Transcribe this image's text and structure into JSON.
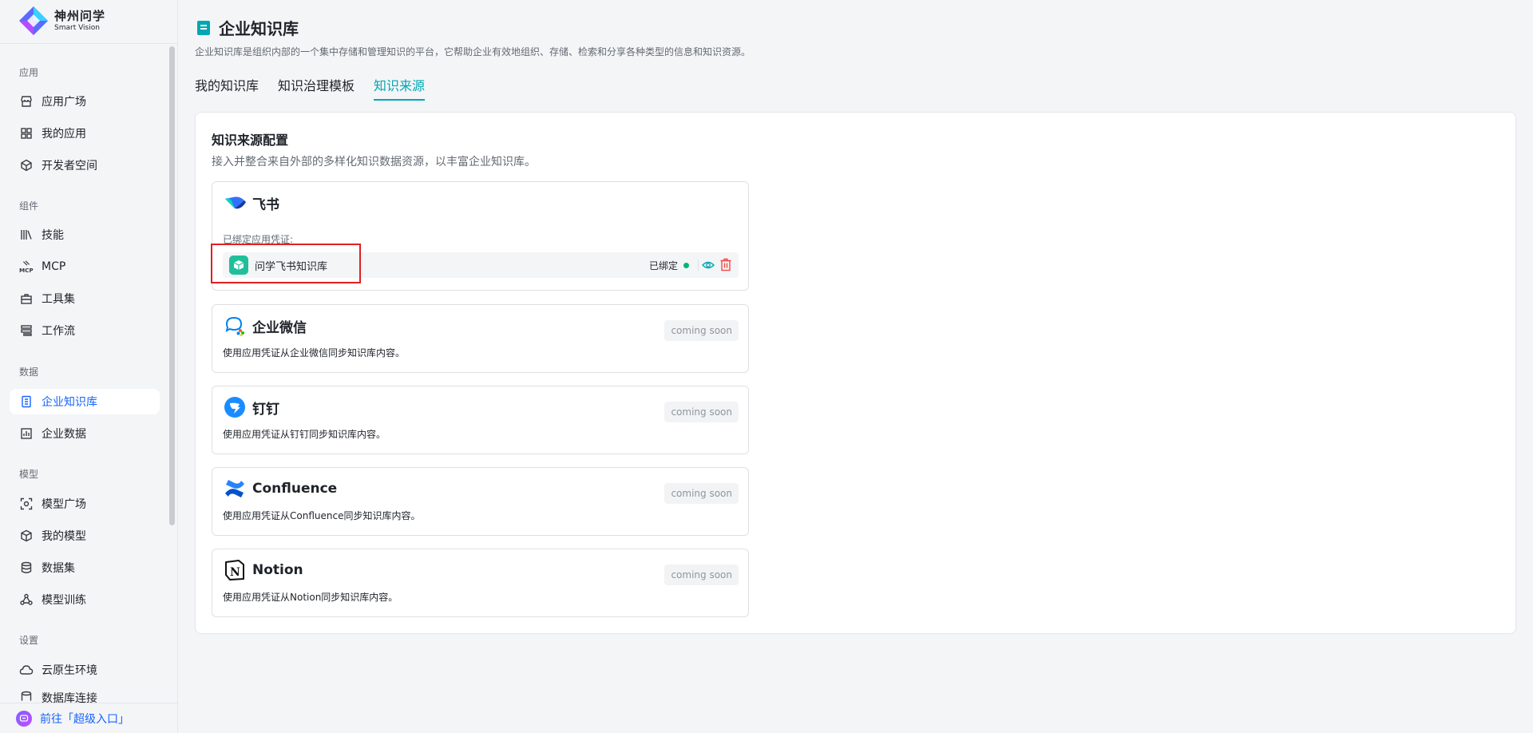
{
  "brand": {
    "name_cn": "神州问学",
    "name_en": "Smart Vision"
  },
  "sidebar": {
    "sections": [
      {
        "title": "应用",
        "items": [
          {
            "label": "应用广场",
            "icon": "store-icon"
          },
          {
            "label": "我的应用",
            "icon": "grid-icon"
          },
          {
            "label": "开发者空间",
            "icon": "cube-network-icon"
          }
        ]
      },
      {
        "title": "组件",
        "items": [
          {
            "label": "技能",
            "icon": "library-icon"
          },
          {
            "label": "MCP",
            "icon": "mcp-icon"
          },
          {
            "label": "工具集",
            "icon": "toolbox-icon"
          },
          {
            "label": "工作流",
            "icon": "workflow-icon"
          }
        ]
      },
      {
        "title": "数据",
        "items": [
          {
            "label": "企业知识库",
            "icon": "knowledge-icon",
            "active": true
          },
          {
            "label": "企业数据",
            "icon": "bar-chart-icon"
          }
        ]
      },
      {
        "title": "模型",
        "items": [
          {
            "label": "模型广场",
            "icon": "scan-icon"
          },
          {
            "label": "我的模型",
            "icon": "box-icon"
          },
          {
            "label": "数据集",
            "icon": "database-icon"
          },
          {
            "label": "模型训练",
            "icon": "training-icon"
          }
        ]
      },
      {
        "title": "设置",
        "items": [
          {
            "label": "云原生环境",
            "icon": "cloud-icon"
          },
          {
            "label": "数据库连接",
            "icon": "database-link-icon"
          }
        ]
      }
    ],
    "footer_label": "前往「超级入口」"
  },
  "page": {
    "title": "企业知识库",
    "description": "企业知识库是组织内部的一个集中存储和管理知识的平台，它帮助企业有效地组织、存储、检索和分享各种类型的信息和知识资源。",
    "tabs": [
      {
        "label": "我的知识库"
      },
      {
        "label": "知识治理模板"
      },
      {
        "label": "知识来源",
        "active": true
      }
    ]
  },
  "panel": {
    "title": "知识来源配置",
    "description": "接入并整合来自外部的多样化知识数据资源，以丰富企业知识库。"
  },
  "sources": [
    {
      "name": "飞书",
      "icon": "feishu-icon",
      "bound_label": "已绑定应用凭证:",
      "credential": {
        "name": "问学飞书知识库",
        "status": "已绑定",
        "status_color": "#00b578"
      }
    },
    {
      "name": "企业微信",
      "icon": "wecom-icon",
      "description": "使用应用凭证从企业微信同步知识库内容。",
      "badge": "coming soon"
    },
    {
      "name": "钉钉",
      "icon": "dingtalk-icon",
      "description": "使用应用凭证从钉钉同步知识库内容。",
      "badge": "coming soon"
    },
    {
      "name": "Confluence",
      "icon": "confluence-icon",
      "description": "使用应用凭证从Confluence同步知识库内容。",
      "badge": "coming soon"
    },
    {
      "name": "Notion",
      "icon": "notion-icon",
      "description": "使用应用凭证从Notion同步知识库内容。",
      "badge": "coming soon"
    }
  ],
  "colors": {
    "accent": "#00a7b3",
    "nav_active": "#1664ff",
    "delete": "#f54a45"
  }
}
